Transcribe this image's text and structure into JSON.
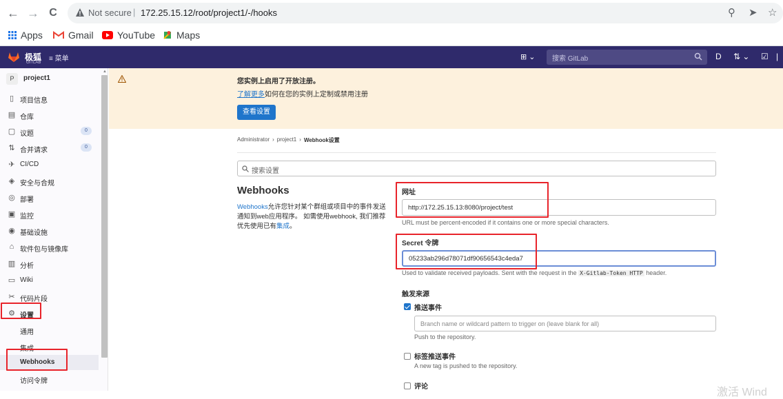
{
  "browser": {
    "back": "←",
    "forward": "→",
    "reload": "C",
    "not_secure": "Not secure",
    "url": "172.25.15.12/root/project1/-/hooks",
    "bookmarks": [
      {
        "label": "Apps",
        "icon": "apps-grid-icon"
      },
      {
        "label": "Gmail",
        "icon": "gmail-icon"
      },
      {
        "label": "YouTube",
        "icon": "youtube-icon"
      },
      {
        "label": "Maps",
        "icon": "maps-icon"
      }
    ]
  },
  "header": {
    "brand": "极狐",
    "brand_sub": "GITLAB",
    "menu": "≡ 菜单",
    "search_placeholder": "搜索 GitLab"
  },
  "sidebar": {
    "project_initial": "P",
    "project_name": "project1",
    "items": [
      {
        "label": "项目信息",
        "icon": "info-icon",
        "glyph": "▯"
      },
      {
        "label": "仓库",
        "icon": "repository-icon",
        "glyph": "▤"
      },
      {
        "label": "议题",
        "icon": "issues-icon",
        "glyph": "▢",
        "count": "0"
      },
      {
        "label": "合并请求",
        "icon": "merge-request-icon",
        "glyph": "⇅",
        "count": "0"
      },
      {
        "label": "CI/CD",
        "icon": "rocket-icon",
        "glyph": "✈"
      },
      {
        "label": "安全与合规",
        "icon": "shield-icon",
        "glyph": "◈"
      },
      {
        "label": "部署",
        "icon": "deploy-icon",
        "glyph": "◎"
      },
      {
        "label": "监控",
        "icon": "monitor-icon",
        "glyph": "▣"
      },
      {
        "label": "基础设施",
        "icon": "infrastructure-icon",
        "glyph": "◉"
      },
      {
        "label": "软件包与镜像库",
        "icon": "package-icon",
        "glyph": "⌂"
      },
      {
        "label": "分析",
        "icon": "chart-icon",
        "glyph": "▥"
      },
      {
        "label": "Wiki",
        "icon": "book-icon",
        "glyph": "▭"
      },
      {
        "label": "代码片段",
        "icon": "snippet-icon",
        "glyph": "✂"
      },
      {
        "label": "设置",
        "icon": "gear-icon",
        "glyph": "⚙"
      }
    ],
    "sub_items": [
      "通用",
      "集成",
      "Webhooks",
      "访问令牌"
    ]
  },
  "banner": {
    "title": "您实例上启用了开放注册。",
    "link": "了解更多",
    "text": "如何在您的实例上定制或禁用注册",
    "button": "查看设置"
  },
  "breadcrumb": [
    "Administrator",
    "project1",
    "Webhook设置"
  ],
  "settings_search_placeholder": "搜索设置",
  "webhooks": {
    "title": "Webhooks",
    "desc_link": "Webhooks",
    "desc_part1": "允许您针对某个群组或项目中的事件发送通知到web应用程序。 如需使用webhook, 我们推荐优先使用已有",
    "desc_link2": "集成",
    "desc_end": "。"
  },
  "form": {
    "url_label": "网址",
    "url_value": "http://172.25.15.13:8080/project/test",
    "url_help": "URL must be percent-encoded if it contains one or more special characters.",
    "secret_label": "Secret 令牌",
    "secret_value": "05233ab296d78071df90656543c4eda7",
    "secret_help_1": "Used to validate received payloads. Sent with the request in the",
    "secret_help_code": "X-Gitlab-Token HTTP",
    "secret_help_2": "header.",
    "trigger_label": "触发来源",
    "push_label": "推送事件",
    "push_checked": true,
    "branch_placeholder": "Branch name or wildcard pattern to trigger on (leave blank for all)",
    "push_help": "Push to the repository.",
    "tag_label": "标签推送事件",
    "tag_help": "A new tag is pushed to the repository.",
    "comment_label": "评论"
  },
  "watermark": "激活 Wind"
}
